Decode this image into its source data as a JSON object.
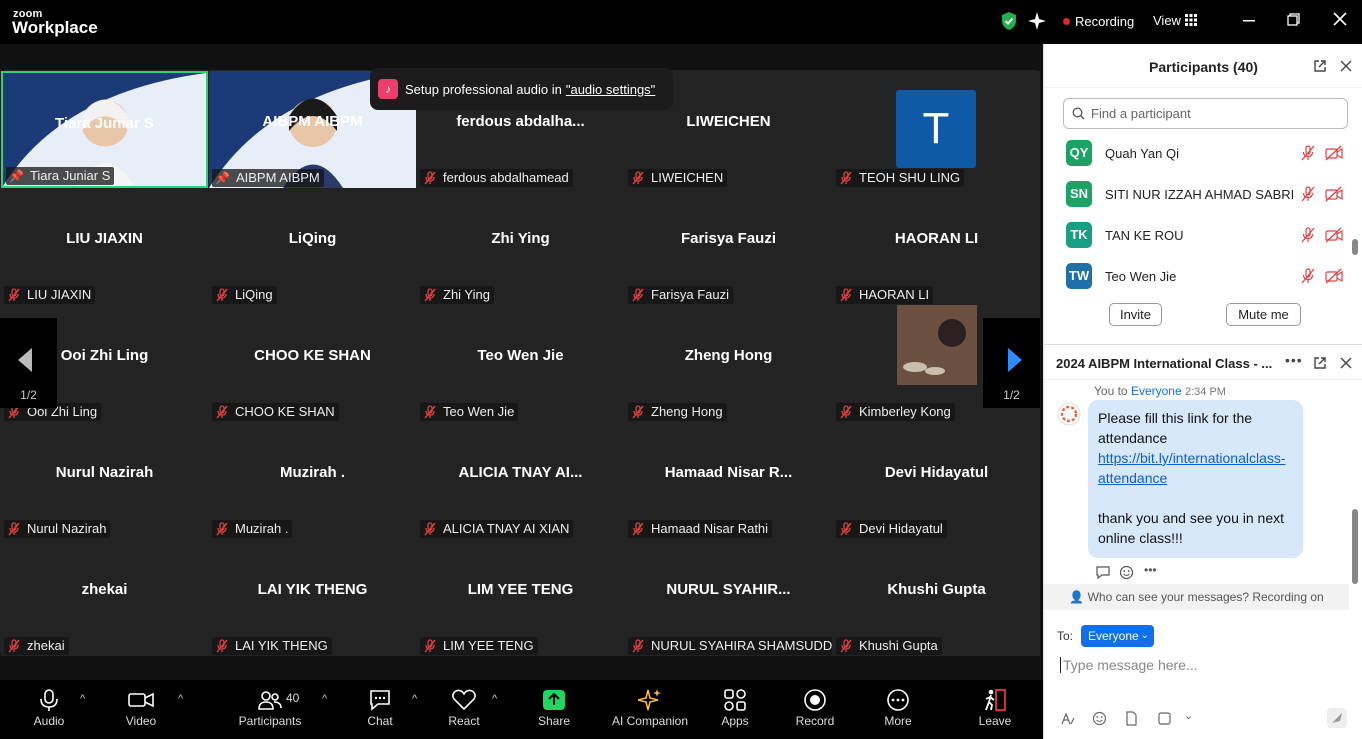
{
  "app": {
    "brand_small": "zoom",
    "brand_large": "Workplace",
    "recording_label": "Recording",
    "view_label": "View"
  },
  "toast": {
    "text": "Setup professional audio in",
    "link": "\"audio settings\""
  },
  "tiles": [
    {
      "name": "Tiara Juniar S",
      "label": "Tiara Juniar S",
      "video": true,
      "active": true
    },
    {
      "name": "AIBPM AIBPM",
      "label": "AIBPM AIBPM",
      "video": true
    },
    {
      "name": "ferdous  abdalha...",
      "label": "ferdous abdalhamead"
    },
    {
      "name": "LIWEICHEN",
      "label": "LIWEICHEN"
    },
    {
      "name": "",
      "label": "TEOH SHU LING",
      "avatar": "T"
    },
    {
      "name": "LIU JIAXIN",
      "label": "LIU JIAXIN"
    },
    {
      "name": "LiQing",
      "label": "LiQing"
    },
    {
      "name": "Zhi Ying",
      "label": "Zhi Ying"
    },
    {
      "name": "Farisya Fauzi",
      "label": "Farisya Fauzi"
    },
    {
      "name": "HAORAN LI",
      "label": "HAORAN LI"
    },
    {
      "name": "Ooi Zhi Ling",
      "label": "Ooi Zhi Ling"
    },
    {
      "name": "CHOO KE SHAN",
      "label": "CHOO KE SHAN"
    },
    {
      "name": "Teo Wen Jie",
      "label": "Teo Wen Jie"
    },
    {
      "name": "Zheng Hong",
      "label": "Zheng Hong"
    },
    {
      "name": "",
      "label": "Kimberley Kong",
      "photo": true
    },
    {
      "name": "Nurul Nazirah",
      "label": "Nurul Nazirah"
    },
    {
      "name": "Muzirah .",
      "label": "Muzirah ."
    },
    {
      "name": "ALICIA TNAY AI...",
      "label": "ALICIA TNAY AI XIAN"
    },
    {
      "name": "Hamaad  Nisar  R...",
      "label": "Hamaad Nisar Rathi"
    },
    {
      "name": "Devi Hidayatul",
      "label": "Devi Hidayatul"
    },
    {
      "name": "zhekai",
      "label": "zhekai"
    },
    {
      "name": "LAI YIK THENG",
      "label": "LAI YIK THENG"
    },
    {
      "name": "LIM YEE TENG",
      "label": "LIM YEE TENG"
    },
    {
      "name": "NURUL  SYAHIR...",
      "label": "NURUL SYAHIRA SHAMSUDDIN"
    },
    {
      "name": "Khushi Gupta",
      "label": "Khushi Gupta"
    }
  ],
  "pager": {
    "left": "1/2",
    "right": "1/2"
  },
  "toolbar": [
    {
      "label": "Audio",
      "icon": "mic-icon"
    },
    {
      "label": "Video",
      "icon": "camera-icon"
    },
    {
      "label": "Participants",
      "icon": "participants-icon",
      "count": "40"
    },
    {
      "label": "Chat",
      "icon": "chat-icon"
    },
    {
      "label": "React",
      "icon": "heart-icon"
    },
    {
      "label": "Share",
      "icon": "share-icon"
    },
    {
      "label": "AI Companion",
      "icon": "sparkle-icon"
    },
    {
      "label": "Apps",
      "icon": "apps-icon"
    },
    {
      "label": "Record",
      "icon": "record-icon"
    },
    {
      "label": "More",
      "icon": "more-icon"
    },
    {
      "label": "Leave",
      "icon": "leave-icon"
    }
  ],
  "participants": {
    "title": "Participants (40)",
    "search_placeholder": "Find a participant",
    "list": [
      {
        "initials": "QY",
        "name": "Quah Yan Qi",
        "color": "#1aa365"
      },
      {
        "initials": "SN",
        "name": "SITI NUR IZZAH AHMAD SABRI",
        "color": "#1aa365"
      },
      {
        "initials": "TK",
        "name": "TAN KE ROU",
        "color": "#1a9e83"
      },
      {
        "initials": "TW",
        "name": "Teo Wen Jie",
        "color": "#1f6fa8"
      }
    ],
    "invite": "Invite",
    "mute_me": "Mute me"
  },
  "chat": {
    "title": "2024 AIBPM International Class - ...",
    "from": "You to",
    "to_name": "Everyone",
    "time": "2:34 PM",
    "msg1": "Please fill this link for the attendance",
    "link": "https://bit.ly/internationalclass-attendance",
    "msg2": "thank you and see you in next online class!!!",
    "who_can_see": "Who can see your messages? Recording on",
    "to_label": "To:",
    "to_value": "Everyone",
    "input_placeholder": "Type message here..."
  }
}
